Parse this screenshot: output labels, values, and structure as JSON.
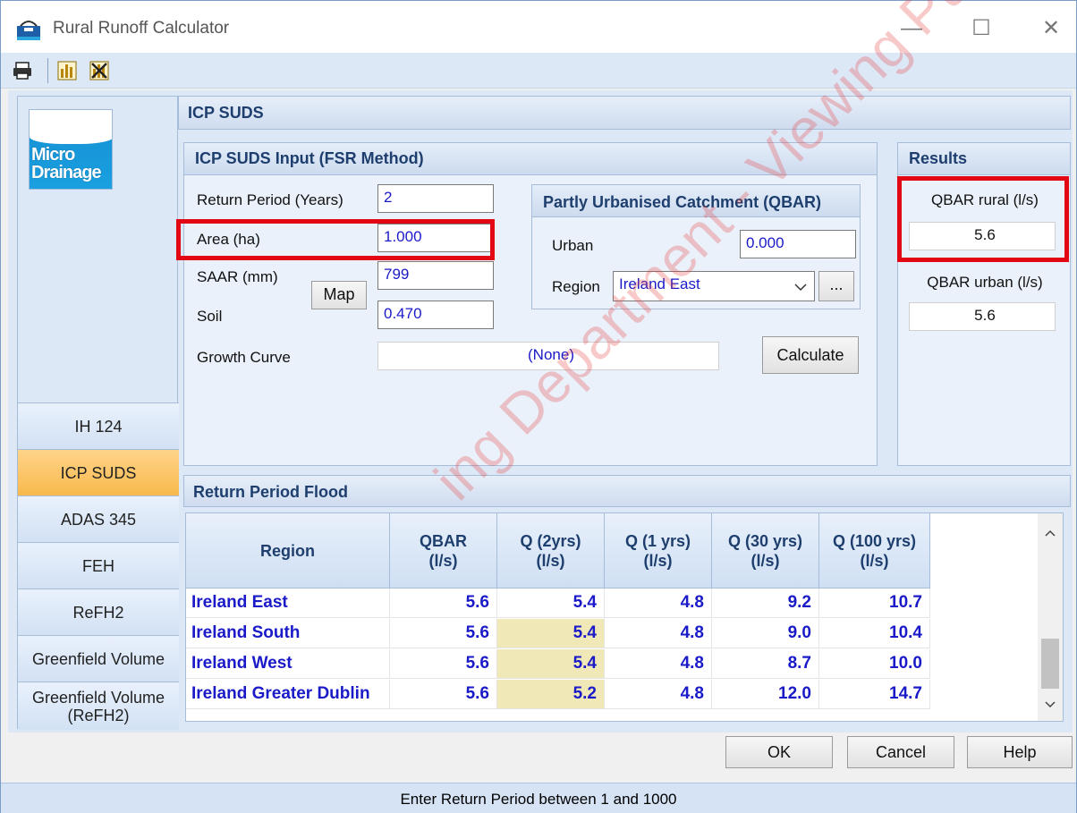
{
  "window": {
    "title": "Rural Runoff Calculator",
    "min_glyph": "—",
    "max_glyph": "☐",
    "close_glyph": "✕"
  },
  "toolbar": {
    "icons": [
      "printer-icon",
      "chart-icon",
      "chart-delete-icon"
    ]
  },
  "sidebar": {
    "logo_line1": "Micro",
    "logo_line2": "Drainage",
    "items": [
      {
        "label": "IH 124",
        "active": false
      },
      {
        "label": "ICP SUDS",
        "active": true
      },
      {
        "label": "ADAS 345",
        "active": false
      },
      {
        "label": "FEH",
        "active": false
      },
      {
        "label": "ReFH2",
        "active": false
      },
      {
        "label": "Greenfield Volume",
        "active": false
      },
      {
        "label": "Greenfield Volume (ReFH2)",
        "active": false
      }
    ]
  },
  "main": {
    "header": "ICP SUDS",
    "input_group": {
      "title": "ICP SUDS Input (FSR Method)",
      "return_period_label": "Return Period (Years)",
      "return_period_value": "2",
      "area_label": "Area (ha)",
      "area_value": "1.000",
      "saar_label": "SAAR (mm)",
      "saar_value": "799",
      "map_label": "Map",
      "soil_label": "Soil",
      "soil_value": "0.470",
      "growth_curve_label": "Growth Curve",
      "growth_curve_value": "(None)",
      "calculate_label": "Calculate"
    },
    "urban_group": {
      "title": "Partly Urbanised Catchment (QBAR)",
      "urban_label": "Urban",
      "urban_value": "0.000",
      "region_label": "Region",
      "region_value": "Ireland East",
      "browse_label": "..."
    },
    "results": {
      "title": "Results",
      "qbar_rural_label": "QBAR rural (l/s)",
      "qbar_rural_value": "5.6",
      "qbar_urban_label": "QBAR urban (l/s)",
      "qbar_urban_value": "5.6"
    },
    "flood": {
      "title": "Return Period Flood",
      "columns": [
        "Region",
        "QBAR (l/s)",
        "Q (2yrs) (l/s)",
        "Q (1 yrs) (l/s)",
        "Q (30 yrs) (l/s)",
        "Q (100 yrs) (l/s)"
      ],
      "col_l1": [
        "Region",
        "QBAR",
        "Q (2yrs)",
        "Q (1 yrs)",
        "Q (30 yrs)",
        "Q (100 yrs)"
      ],
      "col_l2": [
        "",
        "(l/s)",
        "(l/s)",
        "(l/s)",
        "(l/s)",
        "(l/s)"
      ],
      "rows": [
        [
          "Ireland East",
          "5.6",
          "5.4",
          "4.8",
          "9.2",
          "10.7"
        ],
        [
          "Ireland South",
          "5.6",
          "5.4",
          "4.8",
          "9.0",
          "10.4"
        ],
        [
          "Ireland West",
          "5.6",
          "5.4",
          "4.8",
          "8.7",
          "10.0"
        ],
        [
          "Ireland Greater Dublin",
          "5.6",
          "5.2",
          "4.8",
          "12.0",
          "14.7"
        ]
      ]
    }
  },
  "buttons": {
    "ok": "OK",
    "cancel": "Cancel",
    "help": "Help"
  },
  "status": {
    "text": "Enter Return Period between 1 and 1000"
  },
  "watermark": "ing Department - Viewing Purp",
  "colors": {
    "accent": "#1a1ac8",
    "highlight": "#e30613",
    "active_tab": "#f8b94c"
  }
}
